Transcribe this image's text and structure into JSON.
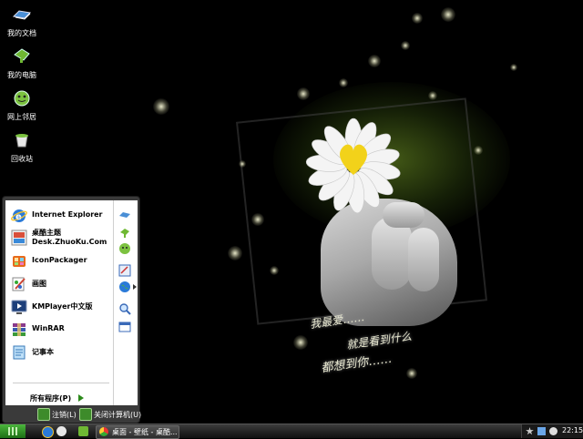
{
  "desktop": {
    "icons": [
      {
        "label": "我的文档",
        "icon": "my-documents-icon"
      },
      {
        "label": "我的电脑",
        "icon": "my-computer-icon"
      },
      {
        "label": "网上邻居",
        "icon": "network-places-icon"
      },
      {
        "label": "回收站",
        "icon": "recycle-bin-icon"
      }
    ],
    "wallpaper_text": {
      "line1": "我最爱……",
      "line1b": "就是看到什么",
      "line2": "都想到你……"
    }
  },
  "start_menu": {
    "items": [
      {
        "line1": "Internet Explorer",
        "icon": "internet-explorer-icon"
      },
      {
        "line1": "桌酷主题",
        "line2": "Desk.ZhuoKu.Com",
        "icon": "zhuoku-theme-icon"
      },
      {
        "line1": "IconPackager",
        "icon": "iconpackager-icon"
      },
      {
        "line1": "画图",
        "icon": "paint-icon"
      },
      {
        "line1": "KMPlayer中文版",
        "icon": "kmplayer-icon"
      },
      {
        "line1": "WinRAR",
        "icon": "winrar-icon"
      },
      {
        "line1": "记事本",
        "icon": "notepad-icon"
      }
    ],
    "all_programs": "所有程序(P)",
    "logoff": "注销(L)",
    "shutdown": "关闭计算机(U)"
  },
  "taskbar": {
    "task_button": "桌面 - 壁纸 - 桌酷...",
    "clock": "22:15"
  },
  "colors": {
    "start_green": "#2c8a1a",
    "taskbar": "#202020",
    "menu_frame": "#3a3a3a"
  }
}
